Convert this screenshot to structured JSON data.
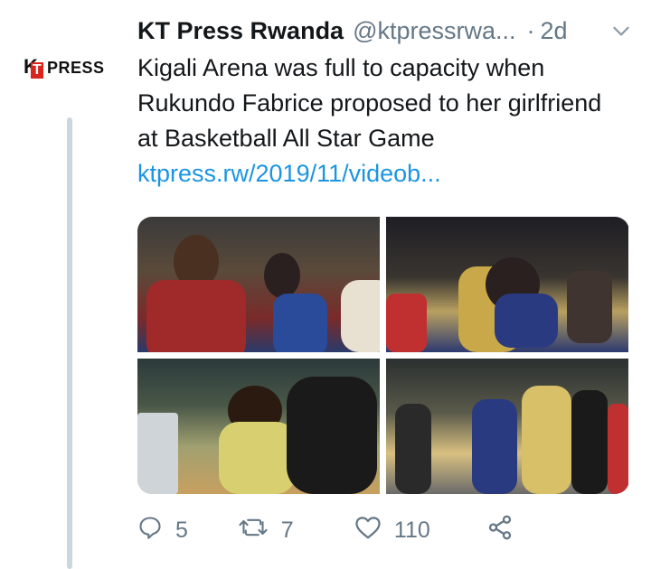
{
  "tweet": {
    "author_name": "KT Press Rwanda",
    "author_handle": "@ktpressrwa...",
    "separator": "·",
    "time": "2d",
    "avatar_logo": "KTPRESS",
    "avatar_logo_k": "K",
    "avatar_logo_t": "T",
    "avatar_logo_rest": "PRESS",
    "text": "Kigali Arena was full to capacity when Rukundo Fabrice proposed to her girlfriend at Basketball All Star Game",
    "link": "ktpress.rw/2019/11/videob...",
    "media_count": 4
  },
  "actions": {
    "replies": "5",
    "retweets": "7",
    "likes": "110"
  },
  "icons": {
    "caret": "chevron-down-icon",
    "reply": "reply-icon",
    "retweet": "retweet-icon",
    "like": "heart-icon",
    "share": "share-icon"
  },
  "colors": {
    "link": "#1b95e0",
    "secondary": "#657786",
    "thread_line": "#ccd6dd",
    "logo_red": "#d9251d"
  }
}
